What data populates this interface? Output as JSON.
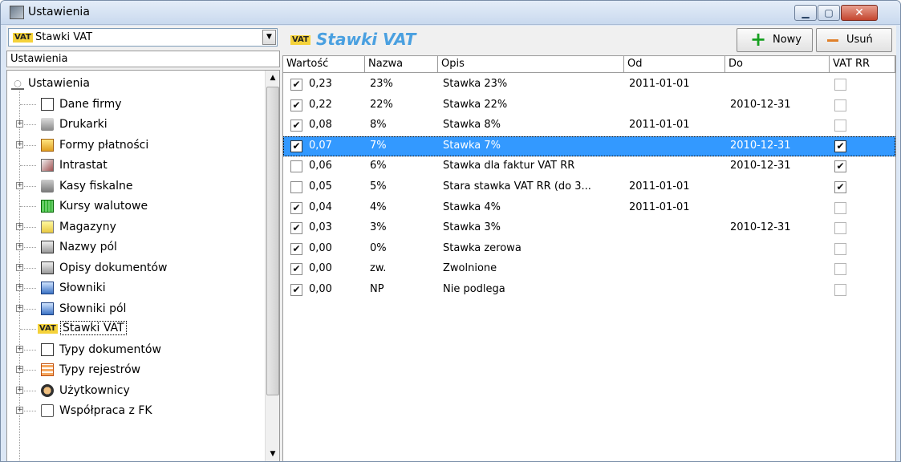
{
  "window": {
    "title": "Ustawienia",
    "controls": [
      "minimize",
      "maximize",
      "close"
    ]
  },
  "left": {
    "combo_badge": "VAT",
    "combo_value": "Stawki VAT",
    "header": "Ustawienia",
    "tree": [
      {
        "label": "Ustawienia",
        "icon": "settings-root-icon",
        "level": 0,
        "expander": ""
      },
      {
        "label": "Dane firmy",
        "icon": "company-card-icon",
        "level": 1,
        "expander": ""
      },
      {
        "label": "Drukarki",
        "icon": "printer-icon",
        "level": 1,
        "expander": "+"
      },
      {
        "label": "Formy płatności",
        "icon": "payment-icon",
        "level": 1,
        "expander": "+"
      },
      {
        "label": "Intrastat",
        "icon": "intrastat-icon",
        "level": 1,
        "expander": ""
      },
      {
        "label": "Kasy fiskalne",
        "icon": "cash-register-icon",
        "level": 1,
        "expander": "+"
      },
      {
        "label": "Kursy walutowe",
        "icon": "currency-table-icon",
        "level": 1,
        "expander": ""
      },
      {
        "label": "Magazyny",
        "icon": "warehouse-icon",
        "level": 1,
        "expander": "+"
      },
      {
        "label": "Nazwy pól",
        "icon": "field-names-icon",
        "level": 1,
        "expander": "+"
      },
      {
        "label": "Opisy dokumentów",
        "icon": "document-desc-icon",
        "level": 1,
        "expander": "+"
      },
      {
        "label": "Słowniki",
        "icon": "dictionary-icon",
        "level": 1,
        "expander": "+"
      },
      {
        "label": "Słowniki pól",
        "icon": "field-dictionary-icon",
        "level": 1,
        "expander": "+"
      },
      {
        "label": "Stawki VAT",
        "icon": "vat-icon",
        "level": 1,
        "expander": "",
        "selected": true
      },
      {
        "label": "Typy dokumentów",
        "icon": "document-types-icon",
        "level": 1,
        "expander": "+"
      },
      {
        "label": "Typy rejestrów",
        "icon": "register-types-icon",
        "level": 1,
        "expander": "+"
      },
      {
        "label": "Użytkownicy",
        "icon": "users-icon",
        "level": 1,
        "expander": "+"
      },
      {
        "label": "Współpraca z FK",
        "icon": "fk-cooperation-icon",
        "level": 1,
        "expander": "+"
      }
    ]
  },
  "right": {
    "badge": "VAT",
    "title": "Stawki VAT",
    "new_label": "Nowy",
    "delete_label": "Usuń",
    "columns": [
      "Wartość",
      "Nazwa",
      "Opis",
      "Od",
      "Do",
      "VAT RR"
    ],
    "rows": [
      {
        "active": true,
        "value": "0,23",
        "name": "23%",
        "desc": "Stawka 23%",
        "from": "2011-01-01",
        "to": "",
        "vat_rr": false
      },
      {
        "active": true,
        "value": "0,22",
        "name": "22%",
        "desc": "Stawka 22%",
        "from": "",
        "to": "2010-12-31",
        "vat_rr": false
      },
      {
        "active": true,
        "value": "0,08",
        "name": "8%",
        "desc": "Stawka 8%",
        "from": "2011-01-01",
        "to": "",
        "vat_rr": false
      },
      {
        "active": true,
        "value": "0,07",
        "name": "7%",
        "desc": "Stawka 7%",
        "from": "",
        "to": "2010-12-31",
        "vat_rr": true,
        "selected": true
      },
      {
        "active": false,
        "value": "0,06",
        "name": "6%",
        "desc": "Stawka dla faktur VAT RR",
        "from": "",
        "to": "2010-12-31",
        "vat_rr": true
      },
      {
        "active": false,
        "value": "0,05",
        "name": "5%",
        "desc": "Stara stawka VAT RR (do 3...",
        "from": "2011-01-01",
        "to": "",
        "vat_rr": true
      },
      {
        "active": true,
        "value": "0,04",
        "name": "4%",
        "desc": "Stawka 4%",
        "from": "2011-01-01",
        "to": "",
        "vat_rr": false
      },
      {
        "active": true,
        "value": "0,03",
        "name": "3%",
        "desc": "Stawka 3%",
        "from": "",
        "to": "2010-12-31",
        "vat_rr": false
      },
      {
        "active": true,
        "value": "0,00",
        "name": "0%",
        "desc": "Stawka zerowa",
        "from": "",
        "to": "",
        "vat_rr": false
      },
      {
        "active": true,
        "value": "0,00",
        "name": "zw.",
        "desc": "Zwolnione",
        "from": "",
        "to": "",
        "vat_rr": false
      },
      {
        "active": true,
        "value": "0,00",
        "name": "NP",
        "desc": "Nie podlega",
        "from": "",
        "to": "",
        "vat_rr": false
      }
    ]
  },
  "colors": {
    "selection": "#3399ff",
    "title_accent": "#4aa0e0",
    "add_green": "#16a020",
    "delete_orange": "#e0802a"
  }
}
